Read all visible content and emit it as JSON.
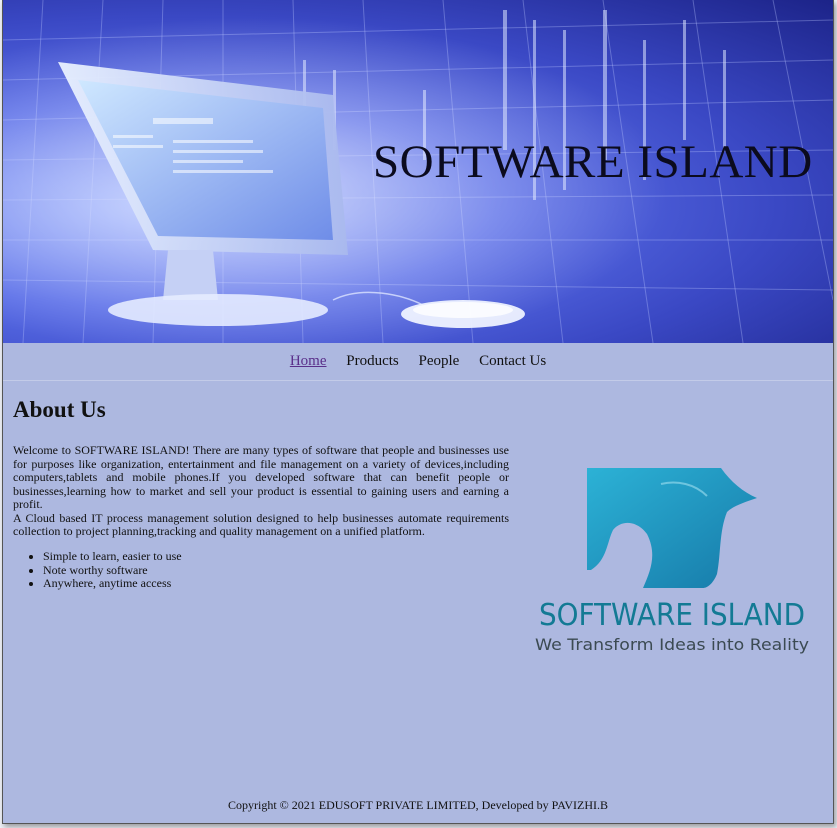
{
  "header": {
    "title": "SOFTWARE ISLAND"
  },
  "nav": {
    "items": [
      "Home",
      "Products",
      "People",
      "Contact Us"
    ],
    "active": "Home"
  },
  "about": {
    "heading": "About Us",
    "paragraphs": [
      "Welcome to SOFTWARE ISLAND! There are many types of software that people and businesses use for purposes like organization, entertainment and file management on a variety of devices,including computers,tablets and mobile phones.If you developed software that can benefit people or businesses,learning how to market and sell your product is essential to gaining users and earning a profit.",
      "A Cloud based IT process management solution designed to help businesses automate requirements collection to project planning,tracking and quality management on a unified platform."
    ],
    "features": [
      "Simple to learn, easier to use",
      "Note worthy software",
      "Anywhere, anytime access"
    ]
  },
  "logo": {
    "name": "SOFTWARE ISLAND",
    "tagline": "We Transform Ideas into Reality",
    "color": "#1aa3c8",
    "text_color": "#137a94"
  },
  "footer": {
    "text": "Copyright © 2021 EDUSOFT PRIVATE LIMITED, Developed by PAVIZHI.B"
  },
  "colors": {
    "page_background": "#adb8e0",
    "banner_blue": "#5a6ee8",
    "link_visited": "#5a2f8a"
  }
}
